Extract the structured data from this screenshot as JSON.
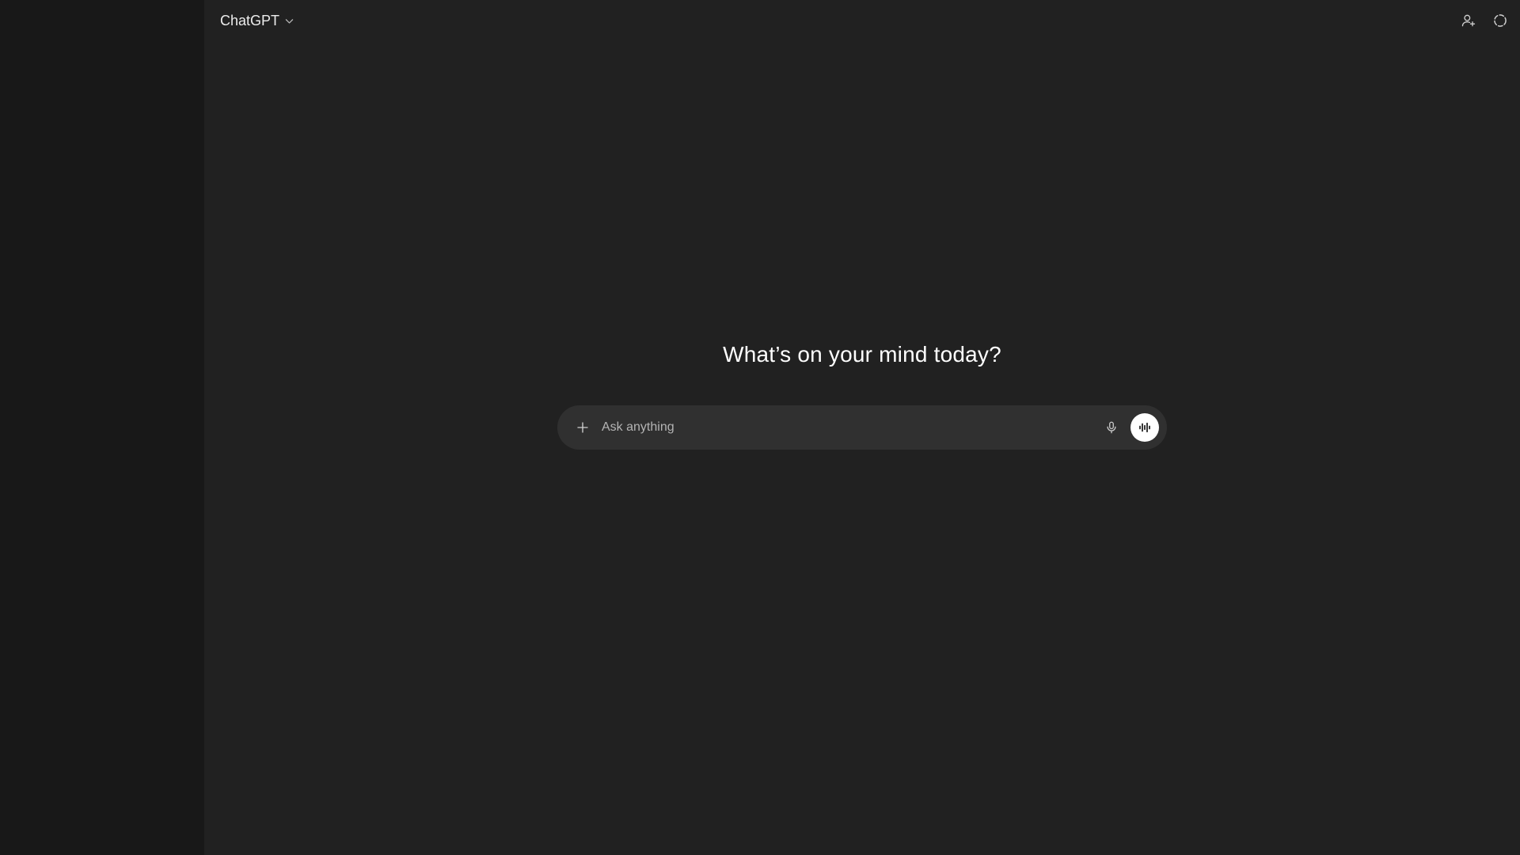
{
  "header": {
    "model_label": "ChatGPT",
    "icons": {
      "model_dropdown": "chevron-down-icon",
      "add_user": "add-user-icon",
      "temporary_chat": "dashed-circle-icon"
    }
  },
  "main": {
    "headline": "What’s on your mind today?"
  },
  "composer": {
    "placeholder": "Ask anything",
    "value": "",
    "icons": {
      "attach": "plus-icon",
      "dictate": "microphone-icon",
      "voice_mode": "sound-wave-icon"
    }
  },
  "colors": {
    "sidebar_bg": "#181818",
    "main_bg": "#212121",
    "composer_bg": "#303030",
    "voice_button_bg": "#ffffff"
  }
}
